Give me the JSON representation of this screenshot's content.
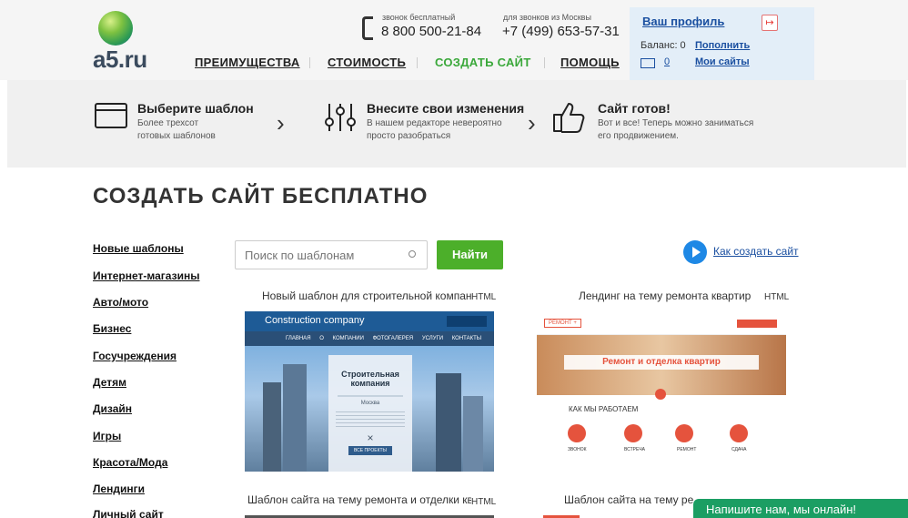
{
  "header": {
    "logo": "a5.ru",
    "nav": [
      "ПРЕИМУЩЕСТВА",
      "СТОИМОСТЬ",
      "СОЗДАТЬ САЙТ",
      "ПОМОЩЬ"
    ],
    "phone_free_label": "звонок бесплатный",
    "phone_free": "8 800 500-21-84",
    "phone_moscow_label": "для звонков из Москвы",
    "phone_moscow": "+7 (499) 653-57-31",
    "profile": {
      "title": "Ваш профиль",
      "balance": "Баланс: 0",
      "topup": "Пополнить",
      "messages": "0",
      "my_sites": "Мои сайты"
    }
  },
  "steps": [
    {
      "title": "Выберите шаблон",
      "desc1": "Более трехсот",
      "desc2": "готовых шаблонов"
    },
    {
      "title": "Внесите свои изменения",
      "desc1": "В нашем редакторе невероятно",
      "desc2": "просто разобраться"
    },
    {
      "title": "Сайт готов!",
      "desc1": "Вот и все! Теперь можно заниматься",
      "desc2": "его продвижением."
    }
  ],
  "page_title": "СОЗДАТЬ САЙТ БЕСПЛАТНО",
  "categories": [
    "Новые шаблоны",
    "Интернет-магазины",
    "Авто/мото",
    "Бизнес",
    "Госучреждения",
    "Детям",
    "Дизайн",
    "Игры",
    "Красота/Мода",
    "Лендинги",
    "Личный сайт"
  ],
  "search": {
    "placeholder": "Поиск по шаблонам",
    "button": "Найти"
  },
  "howto": "Как создать сайт",
  "templates": [
    {
      "title": "Новый шаблон для строительной компании",
      "badge": "HTML"
    },
    {
      "title": "Лендинг на тему ремонта квартир",
      "badge": "HTML"
    },
    {
      "title": "Шаблон сайта на тему ремонта и отделки квартир",
      "badge": "HTML"
    },
    {
      "title": "Шаблон сайта на тему ремонта",
      "badge": ""
    }
  ],
  "thumb1": {
    "brand": "Construction company",
    "menu": [
      "ГЛАВНАЯ",
      "О КОМПАНИИ",
      "ФОТОГАЛЕРЕЯ",
      "УСЛУГИ",
      "КОНТАКТЫ"
    ],
    "heading1": "Строительная",
    "heading2": "компания",
    "city": "Москва",
    "btn": "ВСЕ ПРОЕКТЫ"
  },
  "thumb2": {
    "brand": "РЕМОНТ +",
    "banner": "Ремонт и отделка квартир",
    "section": "КАК МЫ РАБОТАЕМ",
    "steps": [
      "ЗВОНОК",
      "ВСТРЕЧА",
      "РЕМОНТ",
      "СДАЧА"
    ]
  },
  "chat": "Напишите нам, мы онлайн!"
}
